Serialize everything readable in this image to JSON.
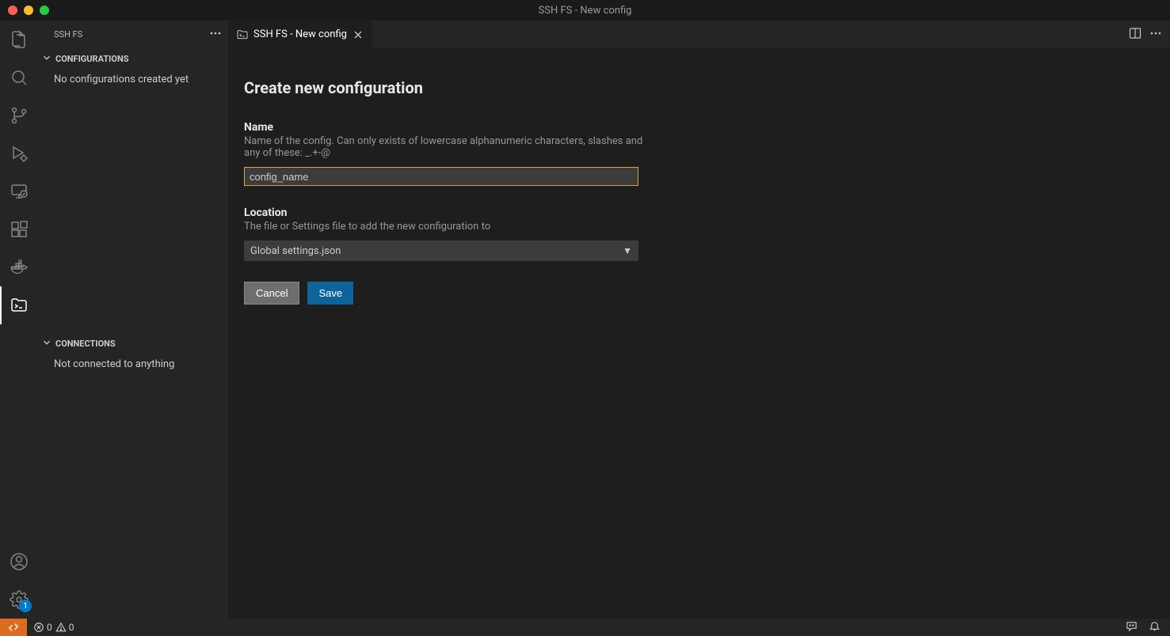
{
  "window_title": "SSH FS - New config",
  "sidebar": {
    "title": "SSH FS",
    "sections": {
      "configurations": {
        "header": "CONFIGURATIONS",
        "body": "No configurations created yet"
      },
      "connections": {
        "header": "CONNECTIONS",
        "body": "Not connected to anything"
      }
    }
  },
  "tab": {
    "label": "SSH FS - New config"
  },
  "form": {
    "title": "Create new configuration",
    "name": {
      "label": "Name",
      "desc": "Name of the config. Can only exists of lowercase alphanumeric characters, slashes and any of these: _.+-@",
      "value": "config_name"
    },
    "location": {
      "label": "Location",
      "desc": "The file or Settings file to add the new configuration to",
      "value": "Global settings.json"
    },
    "buttons": {
      "cancel": "Cancel",
      "save": "Save"
    }
  },
  "activity_badge": "1",
  "status": {
    "errors": "0",
    "warnings": "0"
  }
}
